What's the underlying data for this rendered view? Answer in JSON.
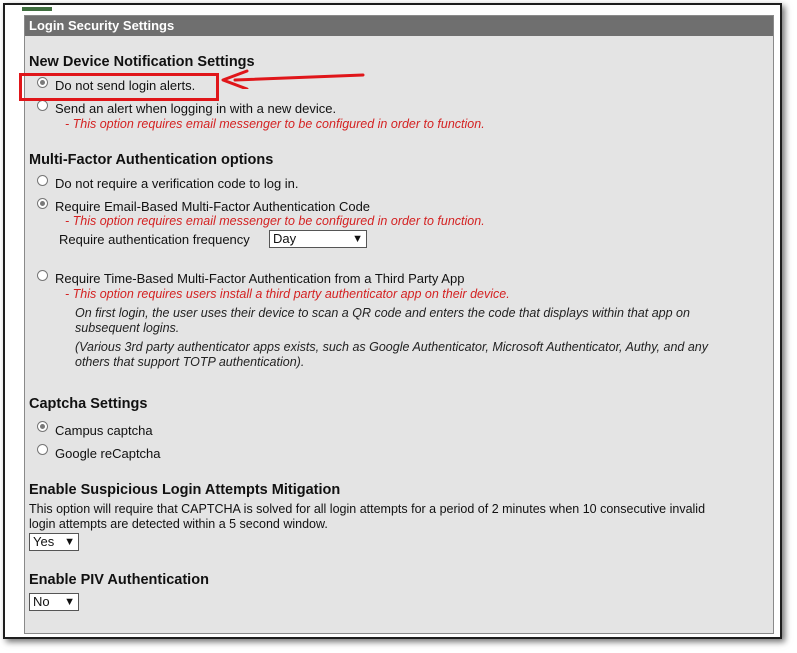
{
  "panel": {
    "title": "Login Security Settings"
  },
  "device_notification": {
    "title": "New Device Notification Settings",
    "options": [
      {
        "label": "Do not send login alerts.",
        "checked": true
      },
      {
        "label": "Send an alert when logging in with a new device.",
        "checked": false
      }
    ],
    "warning": "- This option requires email messenger to be configured in order to function."
  },
  "mfa": {
    "title": "Multi-Factor Authentication options",
    "option_none": {
      "label": "Do not require a verification code to log in.",
      "checked": false
    },
    "option_email": {
      "label": "Require Email-Based Multi-Factor Authentication Code",
      "checked": true
    },
    "email_warning": "- This option requires email messenger to be configured in order to function.",
    "frequency_label": "Require authentication frequency",
    "frequency_value": "Day",
    "option_totp": {
      "label": "Require Time-Based Multi-Factor Authentication from a Third Party App",
      "checked": false
    },
    "totp_warning": "- This option requires users install a third party authenticator app on their device.",
    "totp_note1_line1": "On first login, the user uses their device to scan a QR code and enters the code that displays within that app on",
    "totp_note1_line2": "subsequent logins.",
    "totp_note2_line1": "(Various 3rd party authenticator apps exists, such as Google Authenticator, Microsoft Authenticator, Authy, and any",
    "totp_note2_line2": "others that support TOTP authentication)."
  },
  "captcha": {
    "title": "Captcha Settings",
    "options": [
      {
        "label": "Campus captcha",
        "checked": true
      },
      {
        "label": "Google reCaptcha",
        "checked": false
      }
    ]
  },
  "suspicious": {
    "title": "Enable Suspicious Login Attempts Mitigation",
    "description_line1": "This option will require that CAPTCHA is solved for all login attempts for a period of 2 minutes when 10 consecutive invalid",
    "description_line2": "login attempts are detected within a 5 second window.",
    "value": "Yes"
  },
  "piv": {
    "title": "Enable PIV Authentication",
    "value": "No"
  },
  "colors": {
    "header_bg": "#6f6f6f",
    "panel_bg": "#e4e4e4",
    "warning": "#d42222",
    "annotation": "#e0161a"
  }
}
